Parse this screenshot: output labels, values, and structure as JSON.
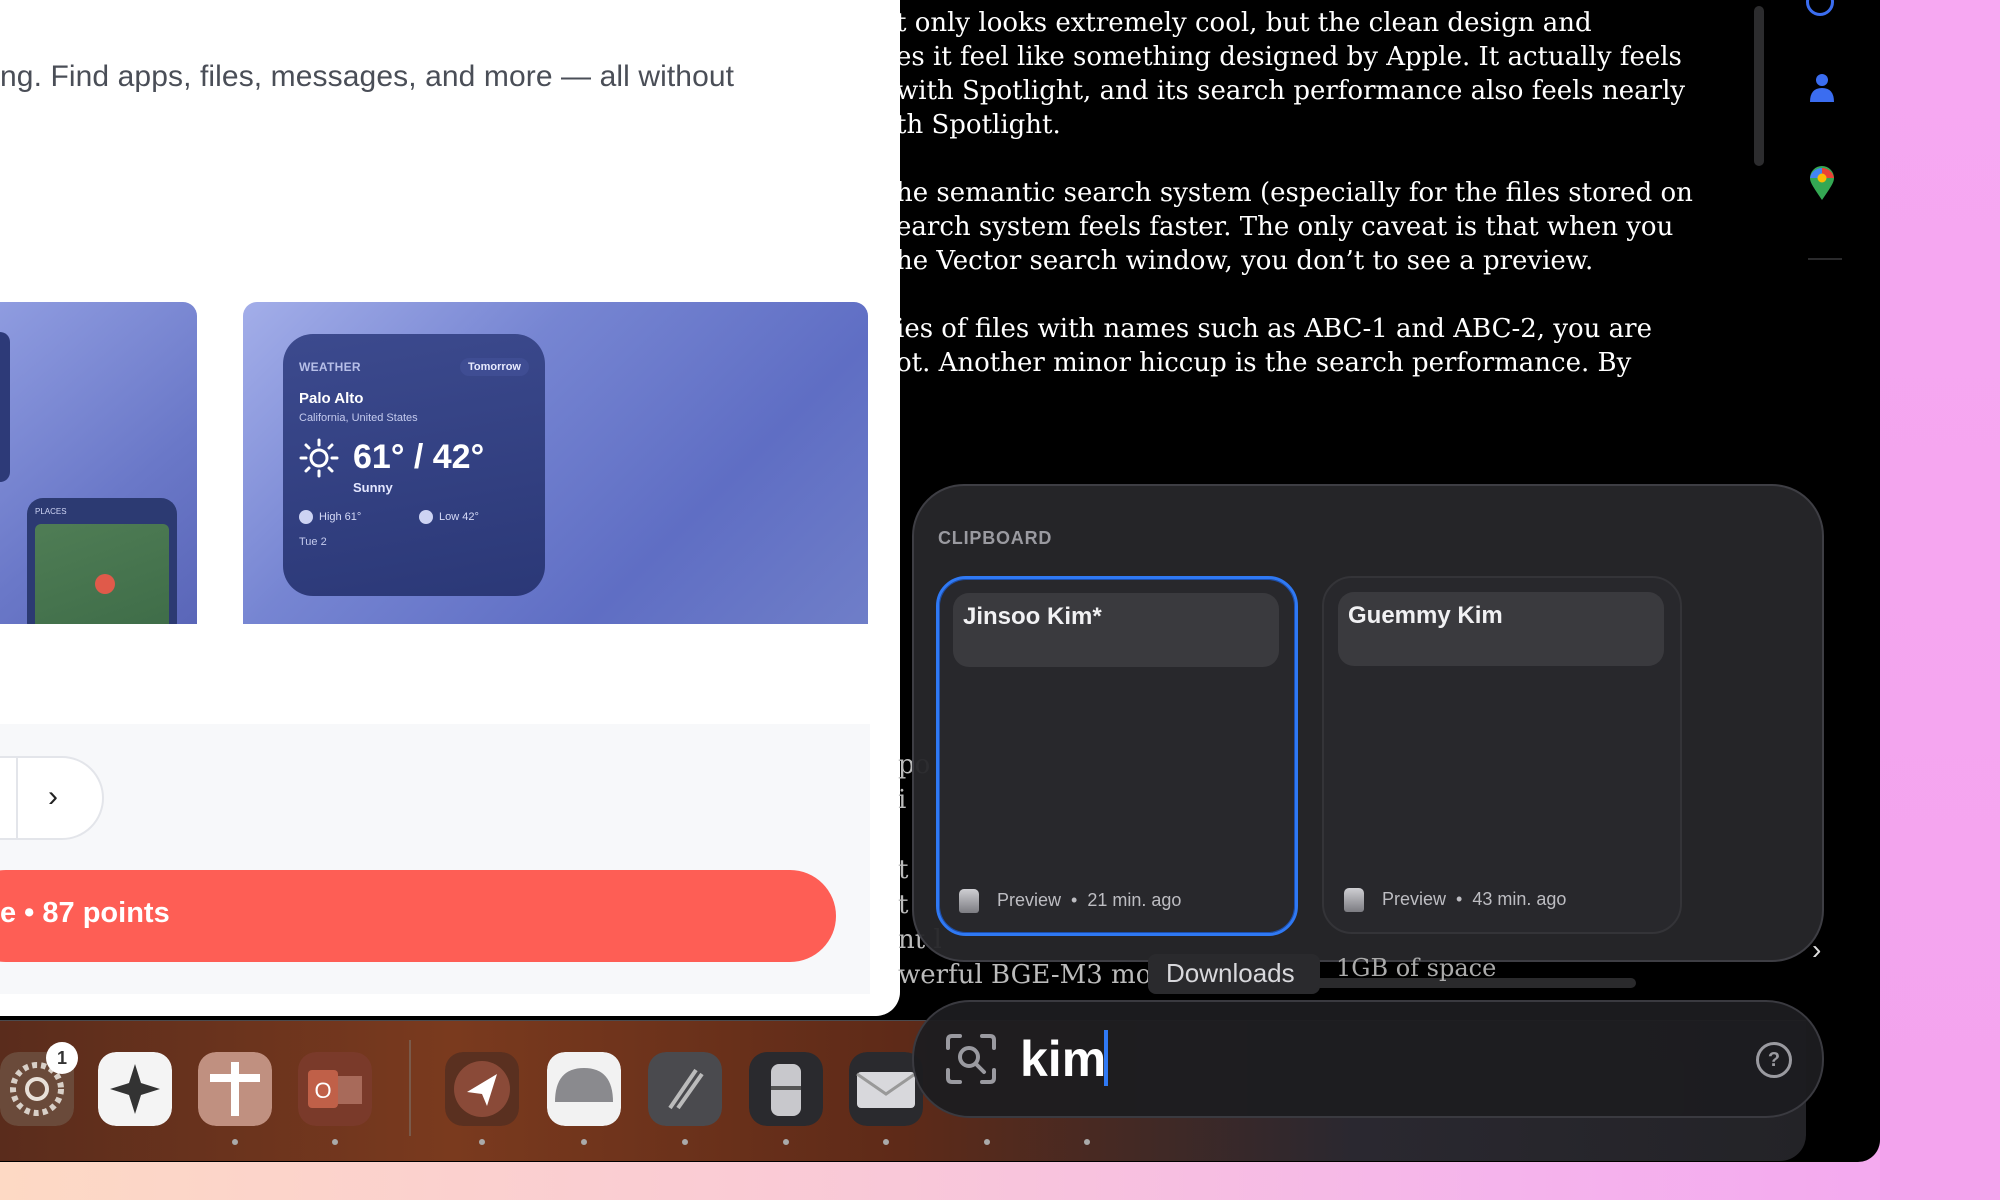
{
  "article": {
    "intro": "ng. Find apps, files, messages, and more — all without"
  },
  "weather_widget": {
    "label": "WEATHER",
    "badge": "Tomorrow",
    "city": "Palo Alto",
    "region": "California, United States",
    "temp": "61° / 42°",
    "condition": "Sunny",
    "high": "High 61°",
    "low": "Low 42°",
    "date": "Tue 2"
  },
  "places_widget": {
    "label": "PLACES"
  },
  "points_button": {
    "label": "e • 87 points"
  },
  "dark_article": {
    "paragraphs": [
      [
        "t only looks extremely cool, but the clean design and",
        "es it feel like something designed by Apple. It actually feels",
        "with Spotlight, and its search performance also feels nearly",
        "th Spotlight."
      ],
      [
        "he semantic search system (especially for the files stored on",
        "earch system feels faster. The only caveat is that when you",
        "he Vector search window, you don’t to see a preview."
      ],
      [
        "ies of files with names such as ABC-1 and ABC-2, you are",
        "ot. Another minor hiccup is the search performance. By"
      ]
    ],
    "behind_fragments": [
      "po",
      "i",
      "t",
      "t",
      "nt l",
      "werful BGE-M3 mod",
      "1GB of space"
    ]
  },
  "clipboard": {
    "title": "CLIPBOARD",
    "items": [
      {
        "name": "Jinsoo Kim*",
        "app": "Preview",
        "time": "21 min. ago",
        "selected": true
      },
      {
        "name": "Guemmy Kim",
        "app": "Preview",
        "time": "43 min. ago",
        "selected": false
      }
    ]
  },
  "tooltip": {
    "downloads": "Downloads",
    "space": "1GB of space"
  },
  "search": {
    "query": "kim",
    "help": "?"
  },
  "dock": {
    "badge_count": "1",
    "apps": [
      "system-settings",
      "spark",
      "toolbox",
      "outlook",
      "paw",
      "bezel",
      "xcode",
      "preview",
      "mail"
    ]
  },
  "colors": {
    "accent": "#2f79f4",
    "points_button": "#fe5e55"
  }
}
